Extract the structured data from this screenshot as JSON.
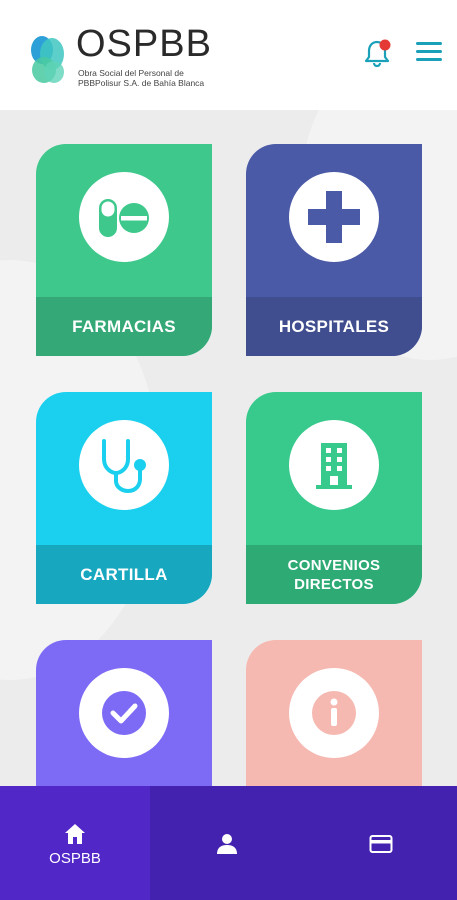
{
  "header": {
    "logo_title": "OSPBB",
    "logo_subtitle": "Obra Social del Personal de PBBPolisur S.A. de Bahía Blanca",
    "bell_icon": "bell-icon",
    "menu_icon": "hamburger-menu-icon"
  },
  "colors": {
    "farmacias": "#3ec88c",
    "farmacias_band": "#34a877",
    "hospitales": "#4b5aa6",
    "hospitales_band": "#404d8f",
    "cartilla": "#1bd0ee",
    "cartilla_band": "#17a8c0",
    "convenios": "#38c98d",
    "convenios_band": "#2eaa75",
    "purple_tile": "#7d6bf6",
    "pink_tile": "#f5b9b1",
    "nav_bg": "#4322b0",
    "nav_active": "#5227c8",
    "notification_dot": "#e53935",
    "accent": "#1aa1b9"
  },
  "tiles": [
    {
      "label": "FARMACIAS",
      "icon": "pills-icon"
    },
    {
      "label": "HOSPITALES",
      "icon": "medical-cross-icon"
    },
    {
      "label": "CARTILLA",
      "icon": "stethoscope-icon"
    },
    {
      "label": "CONVENIOS DIRECTOS",
      "icon": "building-icon"
    },
    {
      "label": "",
      "icon": "check-circle-icon"
    },
    {
      "label": "",
      "icon": "info-circle-icon"
    }
  ],
  "bottom_nav": {
    "items": [
      {
        "label": "OSPBB",
        "icon": "home-icon",
        "active": true
      },
      {
        "label": "",
        "icon": "user-icon",
        "active": false
      },
      {
        "label": "",
        "icon": "credit-card-icon",
        "active": false
      }
    ]
  }
}
